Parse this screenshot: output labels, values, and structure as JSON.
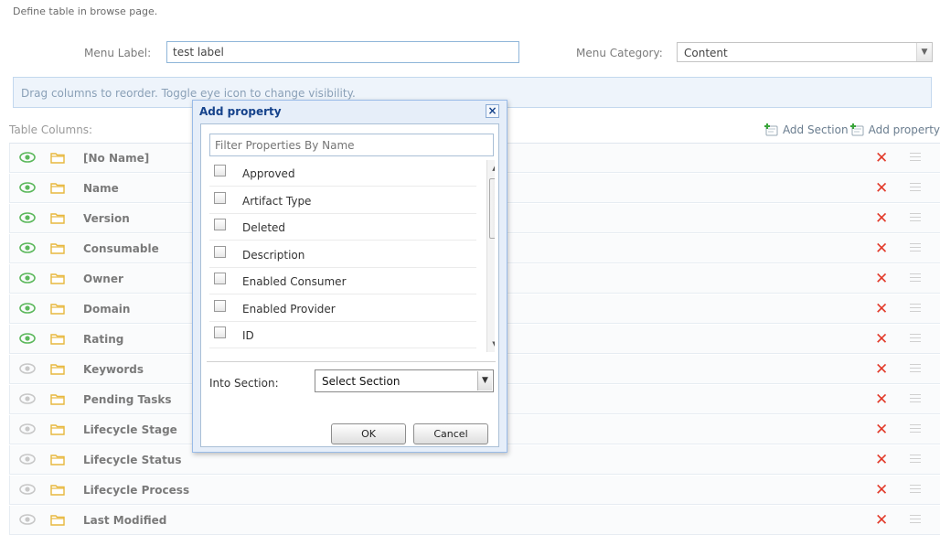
{
  "page": {
    "intro": "Define table in browse page.",
    "menu_label_caption": "Menu Label:",
    "menu_label_value": "test label",
    "menu_category_caption": "Menu Category:",
    "menu_category_value": "Content",
    "info_text": "Drag columns to reorder. Toggle eye icon to change visibility.",
    "table_columns_caption": "Table Columns:",
    "add_section_label": "Add Section",
    "add_property_label": "Add property"
  },
  "columns": [
    {
      "name": "[No Name]",
      "visible": true
    },
    {
      "name": "Name",
      "visible": true
    },
    {
      "name": "Version",
      "visible": true
    },
    {
      "name": "Consumable",
      "visible": true
    },
    {
      "name": "Owner",
      "visible": true
    },
    {
      "name": "Domain",
      "visible": true
    },
    {
      "name": "Rating",
      "visible": true
    },
    {
      "name": "Keywords",
      "visible": false
    },
    {
      "name": "Pending Tasks",
      "visible": false
    },
    {
      "name": "Lifecycle Stage",
      "visible": false
    },
    {
      "name": "Lifecycle Status",
      "visible": false
    },
    {
      "name": "Lifecycle Process",
      "visible": false
    },
    {
      "name": "Last Modified",
      "visible": false
    }
  ],
  "dialog": {
    "title": "Add property",
    "close_label": "×",
    "filter_placeholder": "Filter Properties By Name",
    "properties": [
      "Approved",
      "Artifact Type",
      "Deleted",
      "Description",
      "Enabled Consumer",
      "Enabled Provider",
      "ID"
    ],
    "into_section_label": "Into Section:",
    "section_value": "Select Section",
    "ok_label": "OK",
    "cancel_label": "Cancel"
  },
  "colors": {
    "eye_visible": "#5cb85c",
    "eye_hidden": "#c8c8c8",
    "delete": "#e23a2a",
    "folder": "#e7b83e",
    "dialog_title": "#15428b"
  }
}
